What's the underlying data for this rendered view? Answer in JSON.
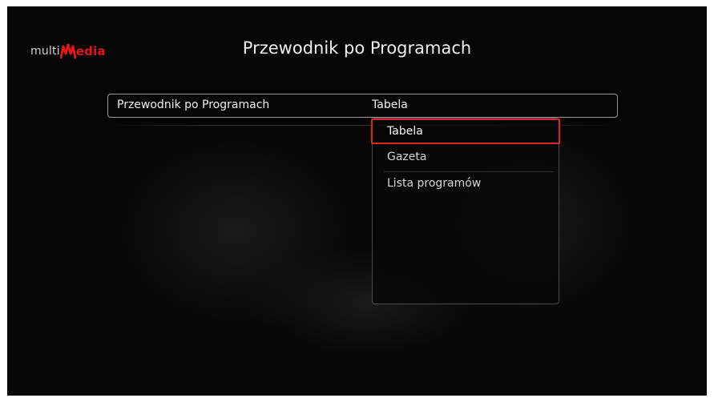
{
  "logo": {
    "prefix": "multi",
    "suffix": "edia",
    "accent_color": "#e01818"
  },
  "header": {
    "title": "Przewodnik po Programach"
  },
  "setting": {
    "label": "Przewodnik po Programach",
    "value": "Tabela"
  },
  "dropdown": {
    "selected_index": 0,
    "highlight_color": "#d8272d",
    "options": [
      {
        "label": "Tabela"
      },
      {
        "label": "Gazeta"
      },
      {
        "label": "Lista programów"
      }
    ]
  }
}
